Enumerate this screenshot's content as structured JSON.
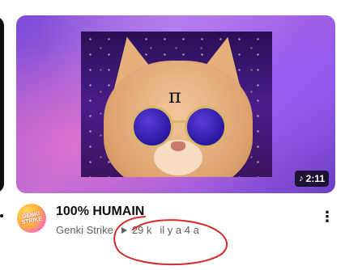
{
  "video": {
    "duration": "2:11",
    "duration_icon": "music-note-icon",
    "title": "100% HUMAIN",
    "channel": "Genki Strike",
    "views": "29 k",
    "age": "il y a 4 a",
    "views_icon": "play-icon",
    "more_icon": "kebab-menu-icon"
  },
  "avatar": {
    "text_line1": "GENKI",
    "text_line2": "STRIKE"
  },
  "thumbnail": {
    "symbol": "π"
  },
  "colors": {
    "title": "#0f0f0f",
    "meta": "#606060",
    "duration_bg": "#000000",
    "annotation_red": "#d62a2a"
  }
}
